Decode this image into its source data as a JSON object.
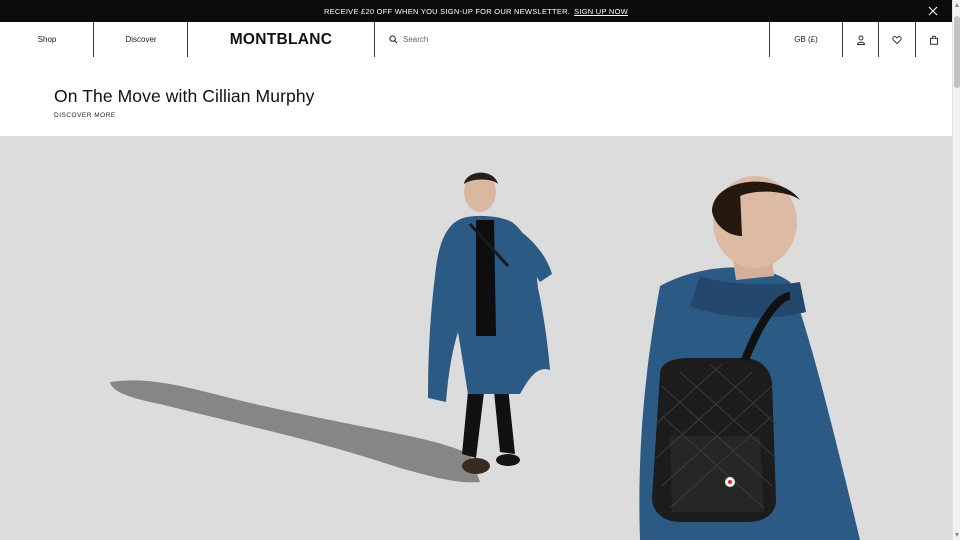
{
  "promo": {
    "text": "RECEIVE £20 OFF WHEN YOU SIGN-UP FOR OUR NEWSLETTER.",
    "link": "SIGN UP NOW",
    "close_icon": "close-icon"
  },
  "header": {
    "shop": "Shop",
    "discover": "Discover",
    "logo": "MONTBLANC",
    "search_placeholder": "Search",
    "region": "GB (£)",
    "icons": [
      "search-icon",
      "user-icon",
      "heart-icon",
      "bag-icon"
    ]
  },
  "hero": {
    "title": "On The Move with Cillian Murphy",
    "cta": "DISCOVER MORE",
    "coat_color": "#2b5a85",
    "backdrop_color": "#dcdcdc"
  }
}
